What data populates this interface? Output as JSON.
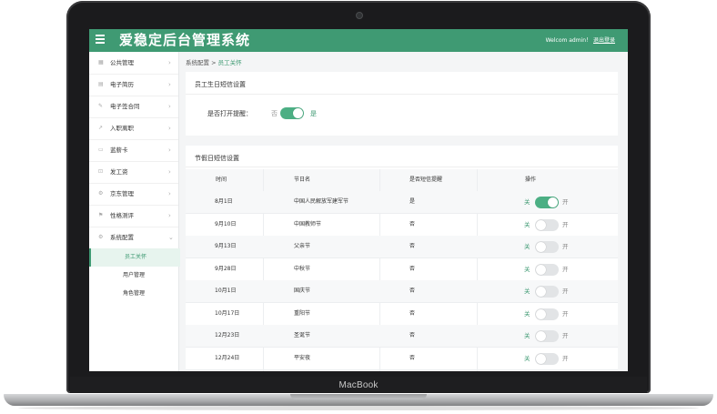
{
  "device": {
    "brand": "MacBook"
  },
  "header": {
    "title": "爱稳定后台管理系统",
    "welcome": "Welcom admin！",
    "logout": "退出登录"
  },
  "sidebar": {
    "items": [
      {
        "label": "公共管理",
        "icon": "grid-icon"
      },
      {
        "label": "电子简历",
        "icon": "document-icon"
      },
      {
        "label": "电子签合同",
        "icon": "pen-icon"
      },
      {
        "label": "入职离职",
        "icon": "trend-icon"
      },
      {
        "label": "蓝薪卡",
        "icon": "card-icon"
      },
      {
        "label": "发工资",
        "icon": "lock-icon"
      },
      {
        "label": "京东管理",
        "icon": "gear-icon"
      },
      {
        "label": "性格测评",
        "icon": "flag-icon"
      },
      {
        "label": "系统配置",
        "icon": "settings-icon"
      }
    ],
    "subitems": [
      {
        "label": "员工关怀",
        "active": true
      },
      {
        "label": "用户管理",
        "active": false
      },
      {
        "label": "角色管理",
        "active": false
      }
    ]
  },
  "breadcrumb": {
    "parent": "系统配置",
    "separator": ">",
    "current": "员工关怀"
  },
  "birthday": {
    "title": "员工生日短信设置",
    "label": "是否打开提醒：",
    "off_label": "否",
    "on_label": "是",
    "enabled": true
  },
  "holiday": {
    "title": "节假日短信设置",
    "columns": [
      "时间",
      "节日名",
      "是否短信提醒",
      "操作"
    ],
    "off_label": "关",
    "on_label": "开",
    "rows": [
      {
        "date": "8月1日",
        "name": "中国人民解放军建军节",
        "remind": "是",
        "enabled": true
      },
      {
        "date": "9月10日",
        "name": "中国教师节",
        "remind": "否",
        "enabled": false
      },
      {
        "date": "9月13日",
        "name": "父亲节",
        "remind": "否",
        "enabled": false
      },
      {
        "date": "9月28日",
        "name": "中秋节",
        "remind": "否",
        "enabled": false
      },
      {
        "date": "10月1日",
        "name": "国庆节",
        "remind": "否",
        "enabled": false
      },
      {
        "date": "10月17日",
        "name": "重阳节",
        "remind": "否",
        "enabled": false
      },
      {
        "date": "12月23日",
        "name": "圣诞节",
        "remind": "否",
        "enabled": false
      },
      {
        "date": "12月24日",
        "name": "平安夜",
        "remind": "否",
        "enabled": false
      }
    ]
  },
  "colors": {
    "accent": "#3f9a73",
    "toggle_on": "#4caf84",
    "toggle_off": "#e2e4e6"
  }
}
